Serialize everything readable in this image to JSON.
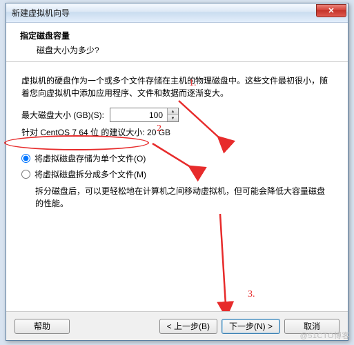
{
  "window_title": "新建虚拟机向导",
  "header": {
    "title": "指定磁盘容量",
    "question": "磁盘大小为多少?"
  },
  "intro": "虚拟机的硬盘作为一个或多个文件存储在主机的物理磁盘中。这些文件最初很小，随着您向虚拟机中添加应用程序、文件和数据而逐渐变大。",
  "disk_size": {
    "label": "最大磁盘大小 (GB)(S):",
    "value": "100",
    "recommendation": "针对 CentOS 7 64 位 的建议大小: 20 GB"
  },
  "options": {
    "single": "将虚拟磁盘存储为单个文件(O)",
    "split": "将虚拟磁盘拆分成多个文件(M)",
    "split_note": "拆分磁盘后，可以更轻松地在计算机之间移动虚拟机，但可能会降低大容量磁盘的性能。"
  },
  "buttons": {
    "help": "帮助",
    "back": "< 上一步(B)",
    "next": "下一步(N) >",
    "cancel": "取消"
  },
  "annotations": {
    "a1": "1.",
    "a2": "2.",
    "a3": "3."
  },
  "watermark": "@51CTO博客",
  "colors": {
    "annotation": "#e72b2b"
  }
}
